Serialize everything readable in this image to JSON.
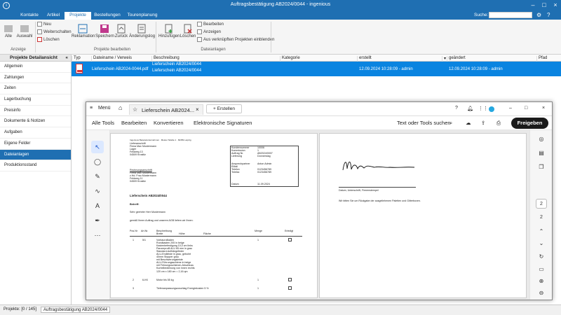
{
  "app": {
    "title": "Auftragsbestätigung AB2024/0044 - ingenious",
    "logo": "i"
  },
  "menu": {
    "tabs": [
      "Kontakte",
      "Artikel",
      "Projekte",
      "Bestellungen",
      "Tourenplanung"
    ],
    "search_label": "Suche:"
  },
  "ribbon": {
    "anzeige": {
      "alle": "Alle",
      "auswahl": "Auswahl",
      "group": "Anzeige"
    },
    "neu": "Neu",
    "weiterschalten": "Weiterschalten",
    "loeschen": "Löschen",
    "bearbeiten_group": {
      "reklamation": "Reklamation",
      "speichern": "Speichern",
      "zurueck": "Zurück",
      "aenderungslog": "Änderungslog",
      "group": "Projekte bearbeiten"
    },
    "dateianlagen_group": {
      "hinzufuegen": "Hinzufügen",
      "loeschen": "Löschen",
      "bearbeiten": "Bearbeiten",
      "anzeigen": "Anzeigen",
      "verknuepft": "Aus verknüpften Projekten einblenden",
      "group": "Dateianlagen"
    }
  },
  "sidebar": {
    "title": "Projekte Detailansicht",
    "collapse": "«",
    "items": [
      "Allgemein",
      "Zahlungen",
      "Zeiten",
      "Lagerbuchung",
      "Preisinfo",
      "Dokumente & Notizen",
      "Aufgaben",
      "Eigene Felder",
      "Dateianlagen",
      "Produktionsstand"
    ]
  },
  "grid": {
    "headers": [
      "Typ",
      "Dateiname / Verweis",
      "Beschreibung",
      "Kategorie",
      "erstellt",
      "geändert",
      "Pfad"
    ],
    "row": {
      "filename": "Lieferschein AB2024-0044.pdf",
      "description1": "Lieferschein AB2024/0044",
      "description2": "Lieferschein AB2024/0044",
      "created": "12.09.2024 10:28:09 - admin",
      "modified": "12.09.2024 10:28:09 - admin"
    }
  },
  "status": {
    "projects": "Projekte: [0 / 145]",
    "tab": "Auftragsbestätigung AB2024/0044"
  },
  "acrobat": {
    "menu": "Menü",
    "tab_name": "Lieferschein AB2024...",
    "new_tab": "+ Erstellen",
    "tools": [
      "Alle Tools",
      "Bearbeiten",
      "Konvertieren",
      "Elektronische Signaturen"
    ],
    "search": "Text oder Tools suchen",
    "share": "Freigeben",
    "page_current": "2",
    "page_total": "2"
  },
  "pdf": {
    "sender": "Ingenious Beispielunternehmen · Muster Straße 1 · 84359 Leipzig",
    "address": [
      "Lieferanschrift",
      "Firma Max Mustermann",
      "Lager",
      "Feldweg 13",
      "04509 Krostitz"
    ],
    "billing": [
      "Rechnungsanschrift",
      "Firma Max Mustermann",
      "z.Hd. Frau Mustermann",
      "Feldweg 11",
      "04509 Krostitz"
    ],
    "info_labels": [
      "Kundennummer",
      "Kommission",
      "Auftrag Nr.",
      "Lieferung",
      "Ansprechpartner",
      "EMail",
      "Telefon",
      "Telefax",
      "Datum"
    ],
    "info_values": [
      "10006",
      "1",
      "AB2024/0007",
      "Donnerstag",
      "Anton Admin",
      "",
      "0123456789",
      "0123456789",
      "11.09.2024"
    ],
    "heading": "Lieferschein AB2024/0044",
    "betreff": "Betreff:",
    "greeting": "Sehr geehrter Herr Mustermann",
    "intro": "gemäß Ihrem Auftrag und unseren AGB liefern wir Ihnen:",
    "table_headers": [
      "Pos.Nr",
      "Art.Nr.",
      "Beschreibung",
      "Menge",
      "Erledigt"
    ],
    "table_sub": [
      "Breite",
      "Höhe",
      "Fläche"
    ],
    "pos1": {
      "nr": "1",
      "art": "5/1",
      "qty": "1"
    },
    "pos1_lines": [
      "Vorbaurollladen",
      "Rundkasten 205 in beige",
      "Kastenbefestigung 10,0 cm links",
      "Panzerprofil ALU 65 mm in grau",
      "Standard-Aufhängefeder",
      "ALU-Endleiste in grau, gebohrt",
      "40mm Stopper grau",
      "mit Beschwerungsleiste",
      "ALU-Führungsschiene in beige",
      "mit Führungsschienen-Abschluss",
      "Kurbelbedienung von innen rechts"
    ],
    "pos1_dims": "120 cm  x  180 cm  =  2,16 qm",
    "pos2": {
      "nr": "2",
      "art": "6-KK",
      "desc": "Motor bis 55 kg",
      "qty": "1"
    },
    "pos3": {
      "nr": "3",
      "desc": "Tiefenanpassungszuschlag Energiekosten 5 %",
      "qty": "1"
    },
    "signature_caption": "Datum, Unterschrift, Firmenstempel",
    "return_note": "Wir bitten Sie um Rückgabe der ausgeliehenen Paletten und Gitterboxen.",
    "signature_text": "Muster"
  },
  "colors": {
    "brand": "#1f6fb2",
    "selection": "#0a84e0"
  }
}
